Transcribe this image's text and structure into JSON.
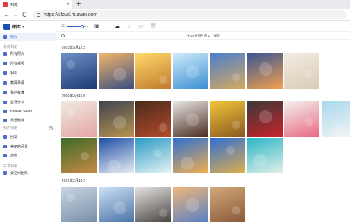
{
  "browser": {
    "tab_title": "图库",
    "close_glyph": "×",
    "new_tab_glyph": "+",
    "url": "https://cloud.huawei.com",
    "back_glyph": "←",
    "forward_glyph": "→",
    "reload_glyph": "C"
  },
  "sidebar": {
    "app_name": "图库",
    "caret": "▾",
    "items": [
      {
        "label": "照片",
        "icon": "photos-icon",
        "active": true
      },
      {
        "label": "所有照片",
        "icon": "all-photos-icon"
      },
      {
        "label": "所有视频",
        "icon": "all-videos-icon"
      },
      {
        "label": "相机",
        "icon": "camera-icon"
      },
      {
        "label": "截屏录屏",
        "icon": "screenshot-icon"
      },
      {
        "label": "我的收藏",
        "icon": "favorites-icon"
      },
      {
        "label": "蓝牙分享",
        "icon": "bluetooth-icon"
      },
      {
        "label": "Huawei Share",
        "icon": "huawei-share-icon"
      },
      {
        "label": "最近删除",
        "icon": "trash-icon"
      },
      {
        "label": "朋友",
        "icon": "friends-icon"
      },
      {
        "label": "美丽的风景",
        "icon": "landscape-album-icon"
      },
      {
        "label": "动物",
        "icon": "animals-album-icon"
      },
      {
        "label": "云空间团队",
        "icon": "cloud-team-icon"
      }
    ],
    "sections": [
      "系统相册",
      "我的相册",
      "共享相册"
    ],
    "add_glyph": "+"
  },
  "toolbar": {
    "zoom_level": 0.7,
    "glyphs": {
      "list": "≡",
      "picture": "▣",
      "upload": "☁",
      "download": "⇩",
      "copy": "▭",
      "delete": "🗑"
    }
  },
  "info": {
    "text": "共 34 张照片和 1 个视频"
  },
  "groups": [
    {
      "date": "2019年5月12日",
      "photos": [
        {
          "name": "mountain-lake",
          "colors": [
            "#6d8fc4",
            "#1d3a73"
          ]
        },
        {
          "name": "sunset-sea",
          "colors": [
            "#f2b56b",
            "#3b4f80"
          ]
        },
        {
          "name": "sunrise-person",
          "colors": [
            "#ffd96a",
            "#c2792c"
          ]
        },
        {
          "name": "iceberg",
          "colors": [
            "#cfeaf8",
            "#3b8fd3"
          ]
        },
        {
          "name": "church-facade",
          "colors": [
            "#4a7fd0",
            "#d6a85e"
          ]
        },
        {
          "name": "sunset-clouds",
          "colors": [
            "#3a5593",
            "#f2a04e"
          ]
        },
        {
          "name": "sand-dunes",
          "colors": [
            "#f2ece2",
            "#d9cbb4"
          ]
        }
      ]
    },
    {
      "date": "2019年3月16日",
      "photos": [
        {
          "name": "macarons",
          "colors": [
            "#efe9e1",
            "#e4a6a6"
          ]
        },
        {
          "name": "food-platter",
          "colors": [
            "#3c4450",
            "#b9924f"
          ]
        },
        {
          "name": "steak-dinner",
          "colors": [
            "#4a2a1c",
            "#b34b2b"
          ]
        },
        {
          "name": "chocolate-cake",
          "colors": [
            "#e9e7e4",
            "#4a2d22"
          ]
        },
        {
          "name": "lemons",
          "colors": [
            "#f1c43a",
            "#8a5a22"
          ]
        },
        {
          "name": "red-apples",
          "colors": [
            "#3a3a3a",
            "#c8222b"
          ]
        },
        {
          "name": "strawberry-cake",
          "colors": [
            "#f4f0ee",
            "#e86a82"
          ]
        },
        {
          "name": "white-flowers",
          "colors": [
            "#a8d9ee",
            "#f4f4f4"
          ]
        },
        {
          "name": "corgi-dog",
          "colors": [
            "#3e6a2a",
            "#c88a45"
          ]
        },
        {
          "name": "sailing-ship",
          "colors": [
            "#1f4fa5",
            "#eaeef5"
          ]
        },
        {
          "name": "surfer-wave",
          "colors": [
            "#2a9bc4",
            "#e8f4f6"
          ]
        },
        {
          "name": "ocean-sunset",
          "colors": [
            "#2e6fd2",
            "#f2b04e"
          ]
        },
        {
          "name": "festival-crowd",
          "colors": [
            "#2f6dd6",
            "#e0b04a"
          ]
        },
        {
          "name": "beach-pier",
          "colors": [
            "#2bb5c8",
            "#e4efe8"
          ]
        }
      ]
    },
    {
      "date": "2019年2月18日",
      "photos": [
        {
          "name": "harbor-city",
          "colors": [
            "#c9d6e4",
            "#7a8fa6"
          ]
        },
        {
          "name": "statue",
          "colors": [
            "#cfe3f5",
            "#4a73a8"
          ]
        },
        {
          "name": "desert-rocks",
          "colors": [
            "#e6e4e2",
            "#4a4542"
          ]
        },
        {
          "name": "sunlit-sky",
          "colors": [
            "#f0b878",
            "#5a7fc5"
          ]
        },
        {
          "name": "hill-town",
          "colors": [
            "#d4a97a",
            "#8a5a3a"
          ]
        }
      ]
    }
  ]
}
